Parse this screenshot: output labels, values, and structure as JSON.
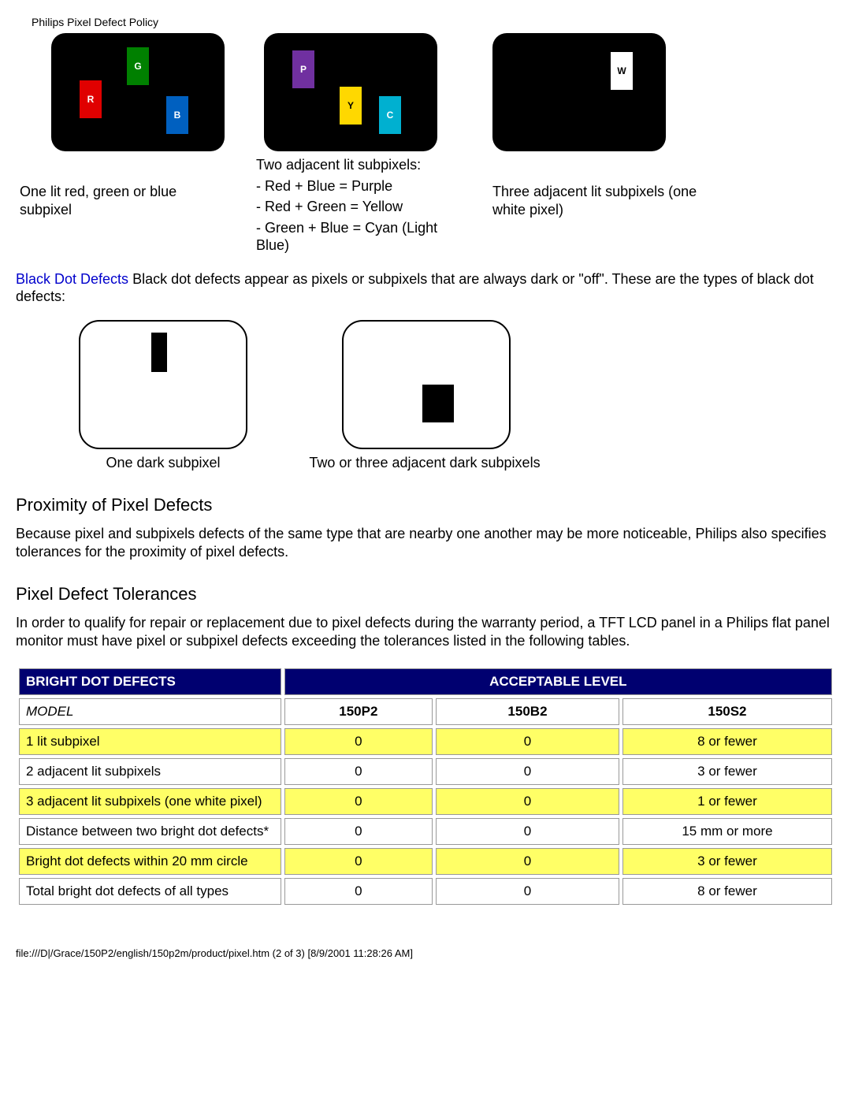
{
  "header": "Philips Pixel Defect Policy",
  "bright": {
    "captions": {
      "one": "One lit red, green or blue subpixel",
      "two_heading": "Two adjacent lit subpixels:",
      "two_lines": [
        "- Red + Blue = Purple",
        "- Red + Green = Yellow",
        "- Green + Blue = Cyan (Light Blue)"
      ],
      "three": "Three adjacent lit subpixels (one white pixel)"
    },
    "labels": {
      "r": "R",
      "g": "G",
      "b": "B",
      "p": "P",
      "y": "Y",
      "c": "C",
      "w": "W"
    }
  },
  "blackdot": {
    "label": "Black Dot Defects",
    "text": " Black dot defects appear as pixels or subpixels that are always dark or \"off\". These are the types of black dot defects:",
    "captions": {
      "one": "One dark subpixel",
      "two": "Two or three adjacent dark subpixels"
    }
  },
  "proximity": {
    "heading": "Proximity of Pixel Defects",
    "text": "Because pixel and subpixels defects of the same type that are nearby one another may be more noticeable, Philips also specifies tolerances for the proximity of pixel defects."
  },
  "tolerances": {
    "heading": "Pixel Defect Tolerances",
    "text": "In order to qualify for repair or replacement due to pixel defects during the warranty period, a TFT LCD panel in a Philips flat panel monitor must have pixel or subpixel defects exceeding the tolerances listed in the following tables."
  },
  "table": {
    "head1": "BRIGHT DOT DEFECTS",
    "head2": "ACCEPTABLE LEVEL",
    "model_label": "MODEL",
    "models": [
      "150P2",
      "150B2",
      "150S2"
    ],
    "rows": [
      {
        "label": "1 lit subpixel",
        "vals": [
          "0",
          "0",
          "8 or fewer"
        ],
        "yellow": true
      },
      {
        "label": "2 adjacent lit subpixels",
        "vals": [
          "0",
          "0",
          "3 or fewer"
        ],
        "yellow": false
      },
      {
        "label": "3 adjacent lit subpixels (one white pixel)",
        "vals": [
          "0",
          "0",
          "1 or fewer"
        ],
        "yellow": true
      },
      {
        "label": "Distance between two bright dot defects*",
        "vals": [
          "0",
          "0",
          "15 mm or more"
        ],
        "yellow": false
      },
      {
        "label": "Bright dot defects within 20 mm circle",
        "vals": [
          "0",
          "0",
          "3 or fewer"
        ],
        "yellow": true
      },
      {
        "label": "Total bright dot defects of all types",
        "vals": [
          "0",
          "0",
          "8 or fewer"
        ],
        "yellow": false
      }
    ]
  },
  "footer": "file:///D|/Grace/150P2/english/150p2m/product/pixel.htm (2 of 3) [8/9/2001 11:28:26 AM]"
}
